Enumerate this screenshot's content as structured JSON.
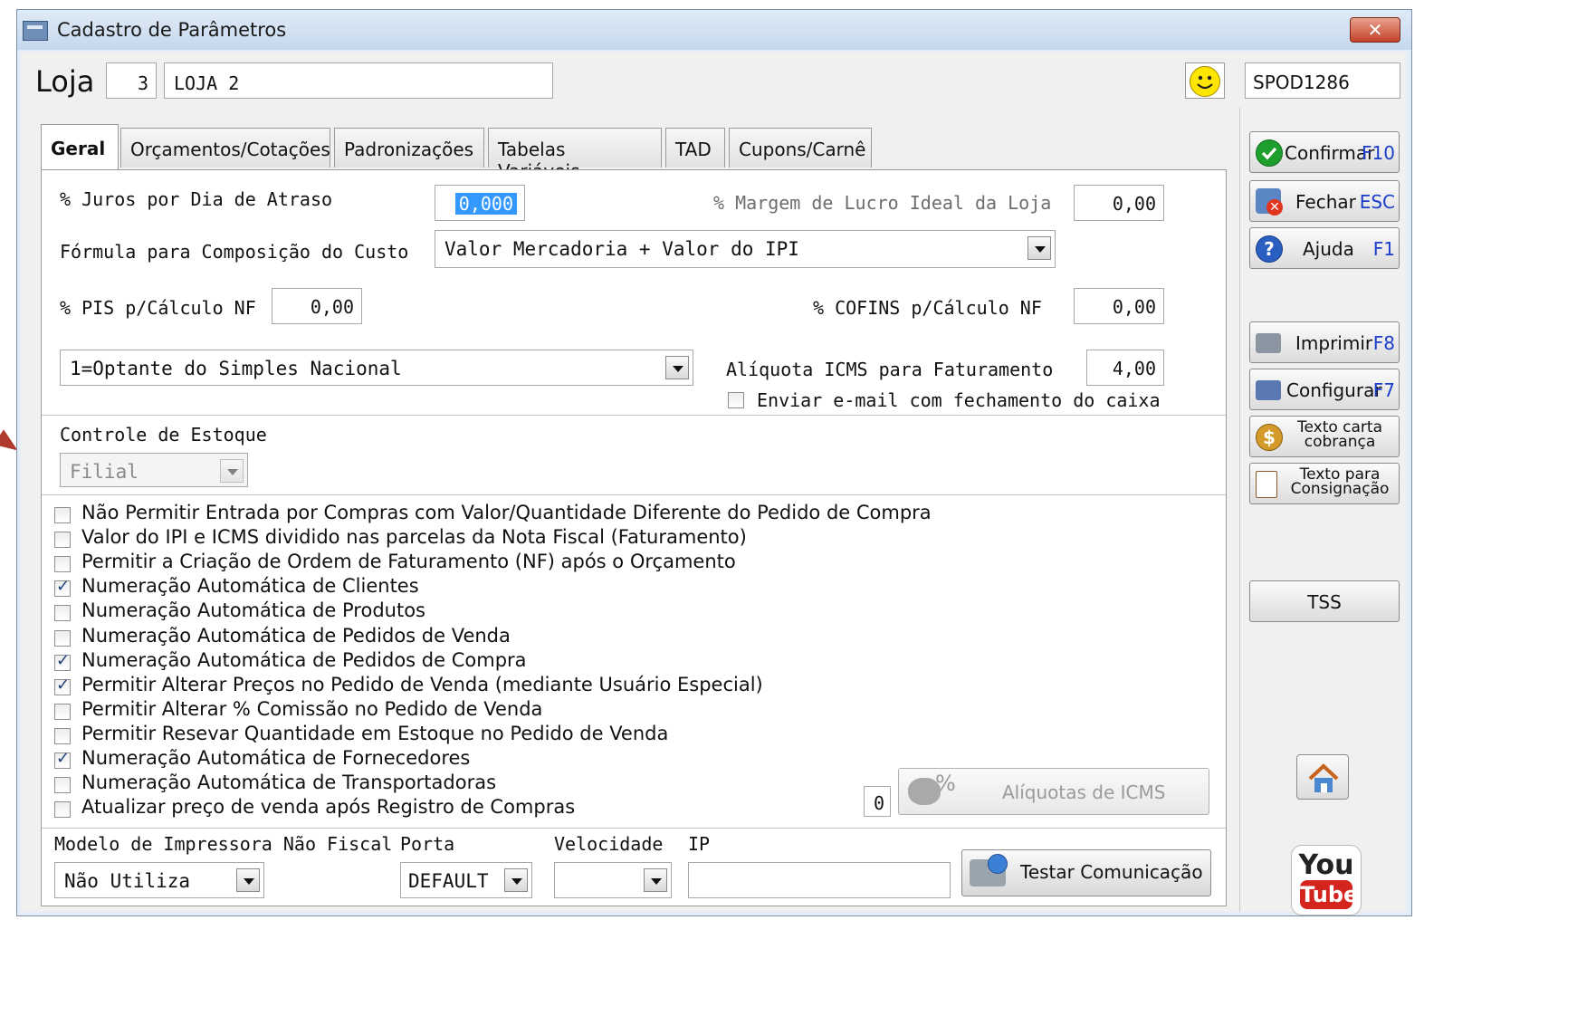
{
  "window": {
    "title": "Cadastro de Parâmetros",
    "close_label": "✕"
  },
  "header": {
    "store_label": "Loja",
    "store_number": "3",
    "store_name": "LOJA 2",
    "server": "SPOD1286"
  },
  "tabs": [
    {
      "label": "Geral",
      "active": true
    },
    {
      "label": "Orçamentos/Cotações",
      "active": false
    },
    {
      "label": "Padronizações",
      "active": false
    },
    {
      "label": "Tabelas Variáveis",
      "active": false
    },
    {
      "label": "TAD",
      "active": false
    },
    {
      "label": "Cupons/Carnê",
      "active": false
    }
  ],
  "general": {
    "juros_label": "% Juros por Dia de Atraso",
    "juros_value": "0,000",
    "margem_label": "% Margem de Lucro Ideal da Loja",
    "margem_value": "0,00",
    "formula_label": "Fórmula para Composição do Custo",
    "formula_value": "Valor Mercadoria + Valor do IPI",
    "pis_label": "% PIS p/Cálculo NF",
    "pis_value": "0,00",
    "cofins_label": "% COFINS p/Cálculo NF",
    "cofins_value": "0,00",
    "regime_value": "1=Optante do Simples Nacional",
    "icms_label": "Alíquota ICMS para Faturamento",
    "icms_value": "4,00",
    "email_label": "Enviar e-mail com fechamento do caixa",
    "email_checked": false,
    "estoque_label": "Controle de Estoque",
    "estoque_value": "Filial"
  },
  "options": [
    {
      "label": "Não Permitir Entrada por Compras com Valor/Quantidade Diferente do Pedido de Compra",
      "checked": false
    },
    {
      "label": "Valor do IPI e ICMS dividido nas parcelas da Nota Fiscal (Faturamento)",
      "checked": false
    },
    {
      "label": "Permitir a Criação de Ordem de Faturamento (NF) após o Orçamento",
      "checked": false
    },
    {
      "label": "Numeração Automática de Clientes",
      "checked": true
    },
    {
      "label": "Numeração Automática de Produtos",
      "checked": false
    },
    {
      "label": "Numeração Automática de Pedidos de Venda",
      "checked": false
    },
    {
      "label": "Numeração Automática de Pedidos de Compra",
      "checked": true
    },
    {
      "label": "Permitir Alterar Preços no Pedido de Venda (mediante Usuário Especial)",
      "checked": true
    },
    {
      "label": "Permitir Alterar % Comissão no Pedido de Venda",
      "checked": false
    },
    {
      "label": "Permitir Resevar Quantidade em Estoque no Pedido de Venda",
      "checked": false
    },
    {
      "label": "Numeração Automática de Fornecedores",
      "checked": true
    },
    {
      "label": "Numeração Automática de Transportadoras",
      "checked": false
    },
    {
      "label": "Atualizar preço de venda após Registro de Compras",
      "checked": false
    }
  ],
  "aliquotas": {
    "count": "0",
    "percent_glyph": "%",
    "button_label": "Alíquotas de ICMS"
  },
  "printer": {
    "model_label": "Modelo de Impressora Não Fiscal",
    "model_value": "Não Utiliza",
    "port_label": "Porta",
    "port_value": "DEFAULT",
    "speed_label": "Velocidade",
    "speed_value": "",
    "ip_label": "IP",
    "ip_value": "",
    "test_button": "Testar Comunicação"
  },
  "sidebar": {
    "confirm": {
      "label": "Confirmar",
      "key": "F10"
    },
    "close": {
      "label": "Fechar",
      "key": "ESC"
    },
    "help": {
      "label": "Ajuda",
      "key": "F1"
    },
    "print": {
      "label": "Imprimir",
      "key": "F8"
    },
    "configure": {
      "label": "Configurar",
      "key": "F7"
    },
    "billing_text": {
      "line1": "Texto carta",
      "line2": "cobrança"
    },
    "consign_text": {
      "line1": "Texto para",
      "line2": "Consignação"
    },
    "tss": {
      "label": "TSS"
    },
    "youtube": {
      "you": "You",
      "tube": "Tube"
    }
  },
  "colors": {
    "key_blue": "#1a3ec9",
    "confirm_green": "#1e9e2c",
    "close_red": "#c4432b"
  }
}
